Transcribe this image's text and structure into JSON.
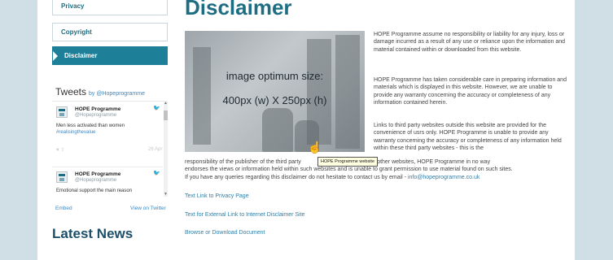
{
  "nav": {
    "privacy": "Privacy",
    "copyright": "Copyright",
    "disclaimer": "Disclaimer"
  },
  "twitter": {
    "title": "Tweets",
    "by": "by @Hopeprogramme",
    "tweets": [
      {
        "name": "HOPE Programme",
        "handle": "@Hopeprogramme",
        "text": "Men less activated than women",
        "hashtag": "#realisingthevalue",
        "actions": "♥  ⇪",
        "date": "26 Apr"
      },
      {
        "name": "HOPE Programme",
        "handle": "@Hopeprogramme",
        "text": "Emotional support the main reason"
      }
    ],
    "embed": "Embed",
    "view_on_twitter": "View on Twitter"
  },
  "latest_news": "Latest News",
  "main": {
    "title": "Disclaimer",
    "image_overlay_line1": "image optimum size:",
    "image_overlay_line2": "400px (w) X 250px (h)",
    "para1": "HOPE Programme assume no responsibility or liability for any injury, loss or damage incurred as a result of any use or reliance upon the information and material contained within or downloaded from this website.",
    "para2": "HOPE Programme has taken considerable care in preparing information and materials which is displayed in this website. However, we are unable to provide any warranty concerning the accuracy or completeness of any information contained herein.",
    "para3a": "Links to third party websites outside this website are provided for the convenience of usrs only. HOPE Programme is unable to provide any warranty concerning the accuracy or completeness of any information held within these third party websites - this is the",
    "para3b_line1": "responsibility of the publisher of the third party",
    "para3b_line1_end": "by linking to other websites, HOPE Programme in no way",
    "para3b_line2": "endorses the views or information held within such websites and is unable to grant permission to use material found on such sites.",
    "para3b_line3": "If you have any queries regarding this disclaimer do not hesitate to contact us by email -",
    "email": "info@hopeprogramme.co.uk",
    "link_privacy": "Text Link to Privacy Page",
    "link_external": "Text for External Link to Internet Disclaimer Site",
    "link_download": "Browse or Download Document"
  },
  "tooltip": "HOPE Programme website"
}
